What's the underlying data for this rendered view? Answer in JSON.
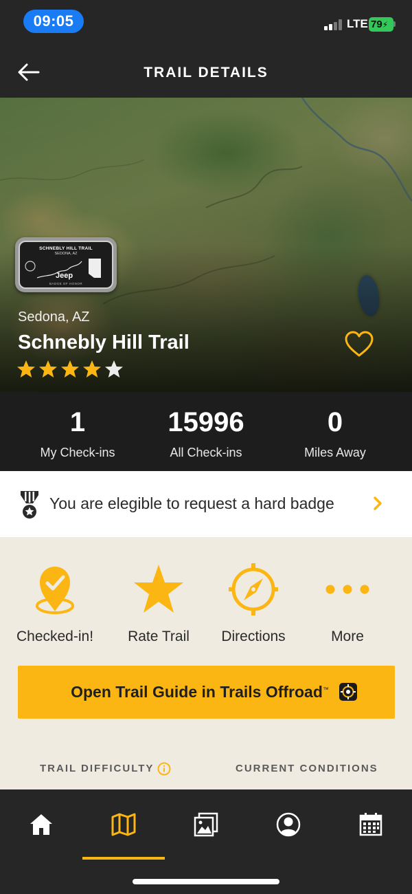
{
  "status_bar": {
    "time": "09:05",
    "network": "LTE",
    "battery": "79"
  },
  "header": {
    "title": "TRAIL DETAILS"
  },
  "trail": {
    "badge_line1": "SCHNEBLY HILL TRAIL",
    "badge_line2": "SEDONA, AZ",
    "badge_brand": "Jeep",
    "badge_line3": "BADGE OF HONOR",
    "location": "Sedona, AZ",
    "name": "Schnebly Hill Trail",
    "rating": 4,
    "rating_max": 5,
    "favorited": false
  },
  "stats": {
    "my_checkins": {
      "value": "1",
      "label": "My Check-ins"
    },
    "all_checkins": {
      "value": "15996",
      "label": "All Check-ins"
    },
    "miles_away": {
      "value": "0",
      "label": "Miles Away"
    }
  },
  "badge_request": {
    "text": "You are elegible to request a hard badge"
  },
  "actions": [
    {
      "label": "Checked-in!",
      "icon": "checked-in-pin-icon"
    },
    {
      "label": "Rate Trail",
      "icon": "star-icon"
    },
    {
      "label": "Directions",
      "icon": "compass-icon"
    },
    {
      "label": "More",
      "icon": "more-dots-icon"
    }
  ],
  "guide_button": {
    "label": "Open Trail Guide in Trails Offroad",
    "trademark": "™"
  },
  "sections": {
    "difficulty": "TRAIL DIFFICULTY",
    "conditions": "CURRENT CONDITIONS"
  },
  "bottom_nav": {
    "items": [
      "home-icon",
      "map-icon",
      "photos-icon",
      "profile-icon",
      "calendar-icon"
    ],
    "active": "map-icon"
  },
  "colors": {
    "accent": "#fbb614",
    "dark_bg": "#262626",
    "panel_bg": "#efebe1",
    "status_time_bg": "#1a7cf5",
    "battery": "#34c759"
  }
}
